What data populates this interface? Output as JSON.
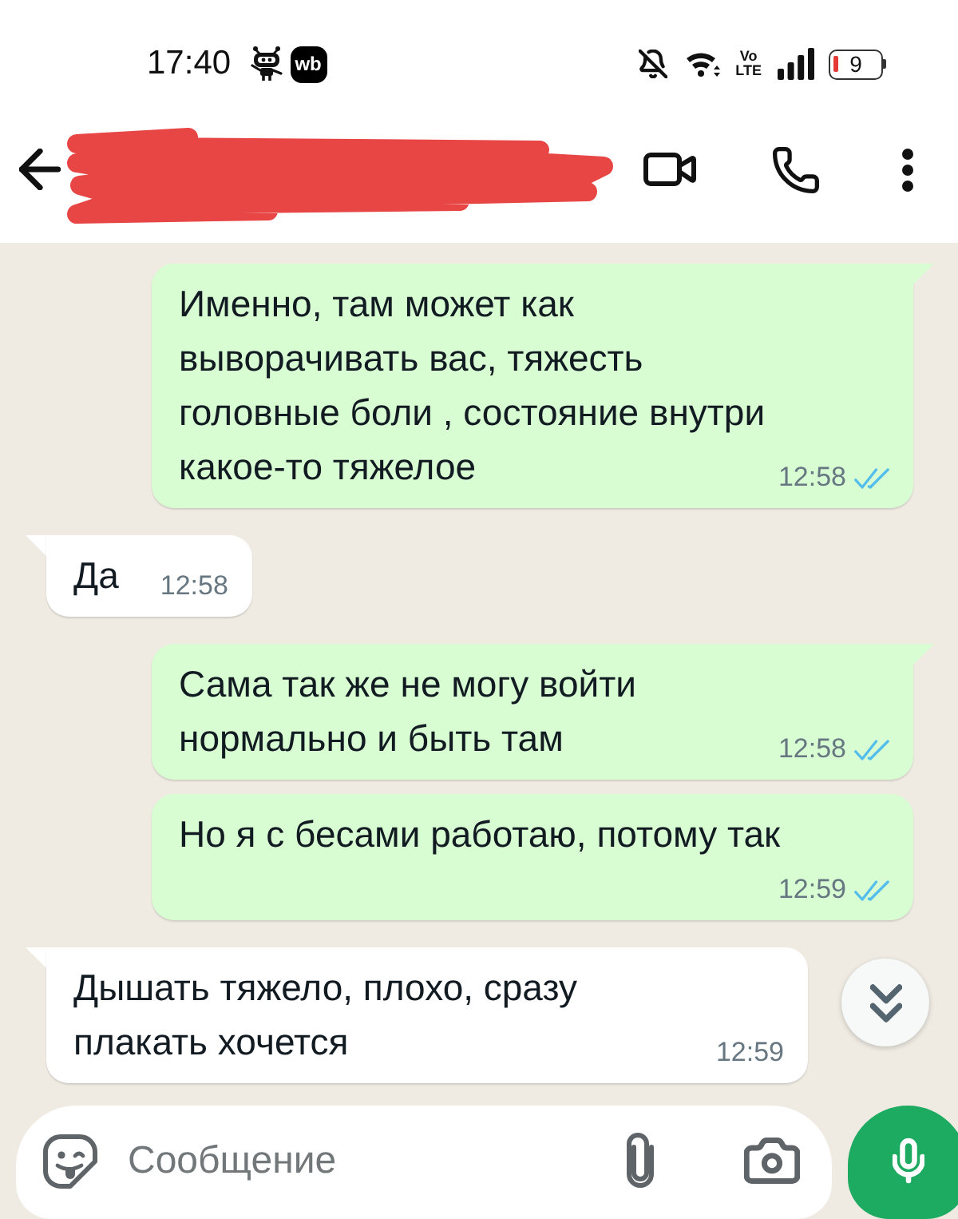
{
  "status_bar": {
    "time": "17:40",
    "app_badge": "wb",
    "volte": "Vo\nLTE",
    "battery": "9"
  },
  "messages": [
    {
      "kind": "outgoing",
      "text": "Именно, там может как\nвыворачивать вас, тяжесть\nголовные боли , состояние внутри\nкакое-то тяжелое",
      "time": "12:58",
      "read": true,
      "tail": true
    },
    {
      "kind": "incoming",
      "text": "Да",
      "time": "12:58",
      "tail": true
    },
    {
      "kind": "outgoing",
      "text": "Сама так же не могу войти\nнормально и быть там",
      "time": "12:58",
      "read": true,
      "tail": true
    },
    {
      "kind": "outgoing",
      "text": "Но я с бесами работаю, потому так",
      "time": "12:59",
      "read": true,
      "tail": false
    },
    {
      "kind": "incoming",
      "text": "Дышать тяжело, плохо, сразу\nплакать хочется",
      "time": "12:59",
      "tail": true
    }
  ],
  "composer": {
    "placeholder": "Сообщение"
  }
}
